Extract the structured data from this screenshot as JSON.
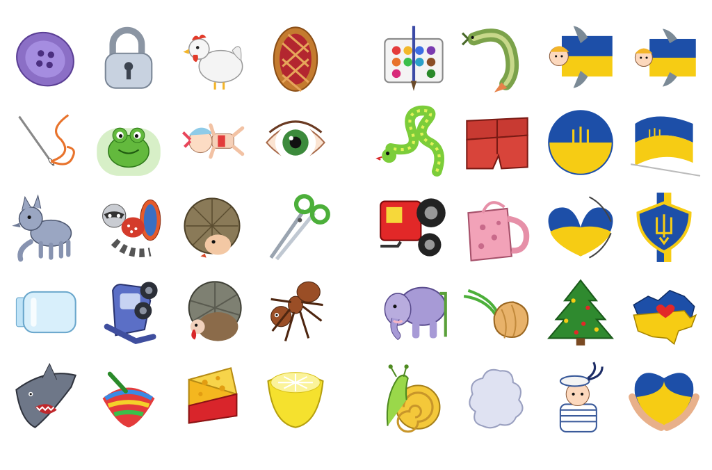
{
  "palette": {
    "ua_blue": "#1d4fa8",
    "ua_yellow": "#f6cc14",
    "outline": "#333333"
  },
  "left_page": {
    "items": [
      {
        "icon": "button-icon"
      },
      {
        "icon": "padlock-icon"
      },
      {
        "icon": "rooster-icon"
      },
      {
        "icon": "pie-icon"
      },
      {
        "icon": "needle-thread-icon"
      },
      {
        "icon": "frog-icon"
      },
      {
        "icon": "doll-icon"
      },
      {
        "icon": "eye-icon"
      },
      {
        "icon": "wolf-icon"
      },
      {
        "icon": "raccoon-icon"
      },
      {
        "icon": "hedgehog-icon"
      },
      {
        "icon": "scissors-icon"
      },
      {
        "icon": "jar-icon"
      },
      {
        "icon": "toy-car-icon"
      },
      {
        "icon": "turkey-icon"
      },
      {
        "icon": "ant-icon"
      },
      {
        "icon": "shark-icon"
      },
      {
        "icon": "spinning-top-icon"
      },
      {
        "icon": "cheese-icon"
      },
      {
        "icon": "lemon-icon"
      }
    ]
  },
  "right_page": {
    "items": [
      {
        "icon": "paint-palette-icon"
      },
      {
        "icon": "pike-fish-icon"
      },
      {
        "icon": "boy-with-flag-icon"
      },
      {
        "icon": "boy-with-flag-small-icon"
      },
      {
        "icon": "snake-icon"
      },
      {
        "icon": "trousers-icon"
      },
      {
        "icon": "trident-circle-icon"
      },
      {
        "icon": "ukraine-flag-icon"
      },
      {
        "icon": "tractor-icon"
      },
      {
        "icon": "mug-icon"
      },
      {
        "icon": "heart-hands-icon"
      },
      {
        "icon": "trident-shield-icon"
      },
      {
        "icon": "elephant-icon"
      },
      {
        "icon": "onion-icon"
      },
      {
        "icon": "christmas-tree-icon"
      },
      {
        "icon": "ukraine-map-icon"
      },
      {
        "icon": "snail-icon"
      },
      {
        "icon": "cloud-icon"
      },
      {
        "icon": "sailor-boy-icon"
      },
      {
        "icon": "heart-palms-icon"
      }
    ]
  }
}
